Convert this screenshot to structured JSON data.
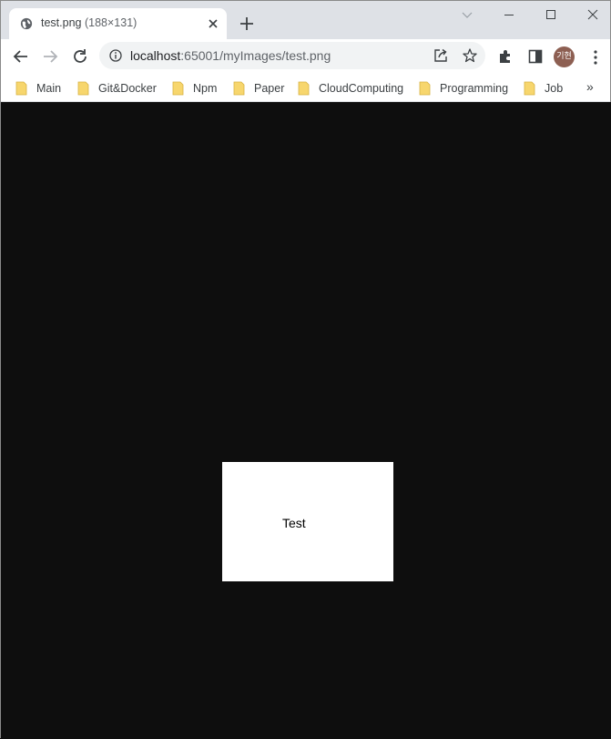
{
  "tab": {
    "title": "test.png",
    "dimensions": "(188×131)",
    "favicon": "globe-icon"
  },
  "address": {
    "host": "localhost",
    "path": ":65001/myImages/test.png"
  },
  "profile": {
    "avatar_text": "기현",
    "color": "#8d5f52"
  },
  "bookmarks": [
    {
      "label": "Main"
    },
    {
      "label": "Git&Docker"
    },
    {
      "label": "Npm"
    },
    {
      "label": "Paper"
    },
    {
      "label": "CloudComputing"
    },
    {
      "label": "Programming"
    },
    {
      "label": "Job"
    }
  ],
  "bookmarks_overflow": "»",
  "image": {
    "text": "Test"
  },
  "colors": {
    "folder": "#f7d66d",
    "page_bg": "#0e0e0e",
    "tabstrip": "#dee1e6"
  }
}
